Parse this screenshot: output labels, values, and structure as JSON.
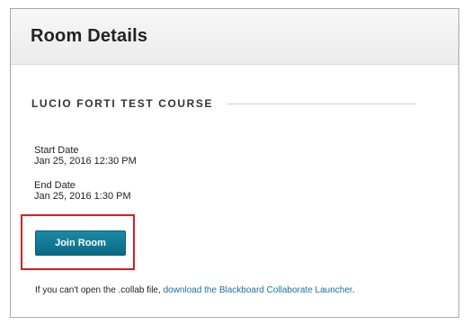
{
  "panel": {
    "title": "Room Details"
  },
  "course": {
    "name": "LUCIO FORTI TEST COURSE"
  },
  "start": {
    "label": "Start Date",
    "value": "Jan 25, 2016 12:30 PM"
  },
  "end": {
    "label": "End Date",
    "value": "Jan 25, 2016 1:30 PM"
  },
  "actions": {
    "join_label": "Join Room"
  },
  "help": {
    "prefix": "If you can't open the .collab file, ",
    "link_text": "download the Blackboard Collaborate Launcher",
    "suffix": "."
  },
  "colors": {
    "button": "#0b6a85",
    "highlight": "#d61f26",
    "link": "#1a6fa3"
  }
}
